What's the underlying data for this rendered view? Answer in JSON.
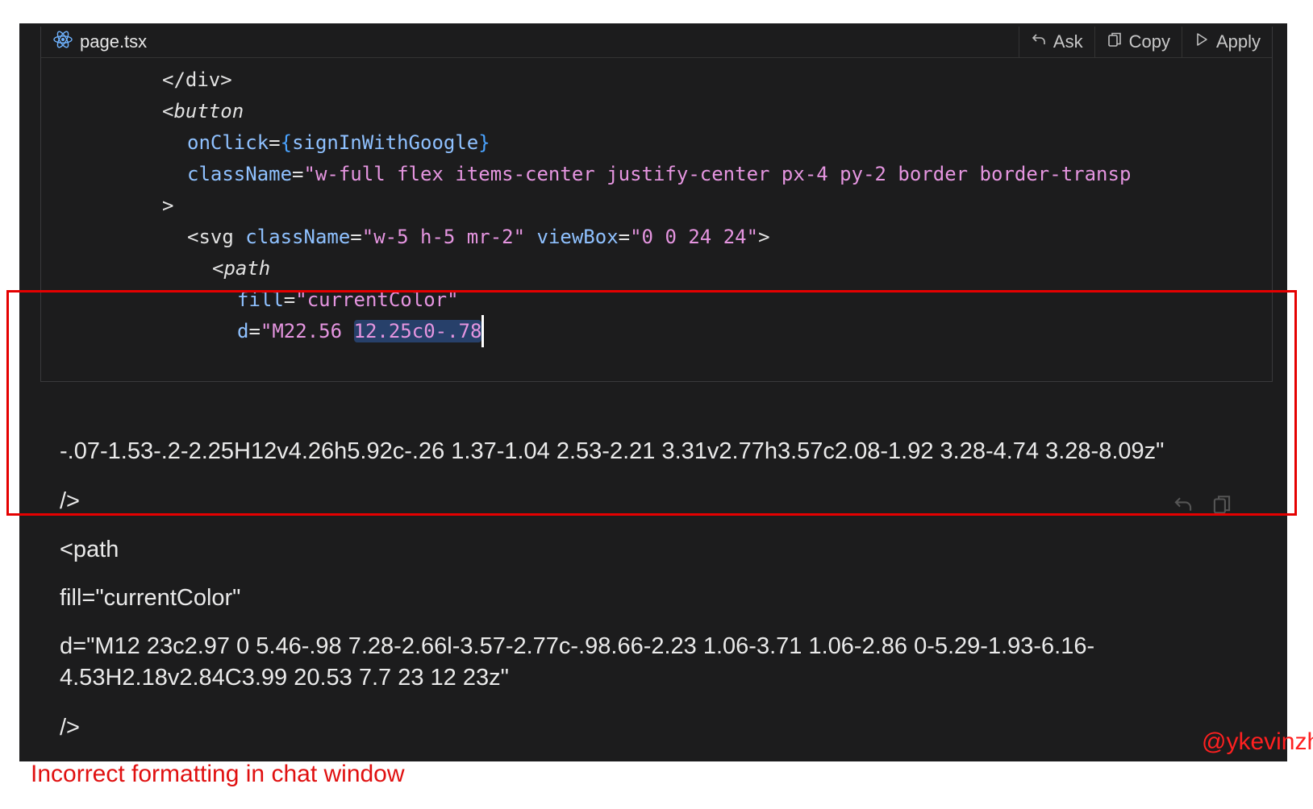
{
  "codeblock": {
    "filename": "page.tsx",
    "file_icon": "react-atom-icon",
    "actions": [
      {
        "label": "Ask",
        "icon": "undo-arrow-icon"
      },
      {
        "label": "Copy",
        "icon": "copy-icon"
      },
      {
        "label": "Apply",
        "icon": "play-icon"
      }
    ],
    "lines": {
      "l1": "</div>",
      "l2": "<button",
      "l3_attr": "onClick",
      "l3_eq": "=",
      "l3_open": "{",
      "l3_val": "signInWithGoogle",
      "l3_close": "}",
      "l4_attr": "className",
      "l4_eq": "=",
      "l4_val": "\"w-full flex items-center justify-center px-4 py-2 border border-transp",
      "l5": ">",
      "l6_tag": "<svg",
      "l6_attr1": "className",
      "l6_eq1": "=",
      "l6_val1": "\"w-5 h-5 mr-2\"",
      "l6_attr2": "viewBox",
      "l6_eq2": "=",
      "l6_val2": "\"0 0 24 24\"",
      "l6_end": ">",
      "l7": "<path",
      "l8_attr": "fill",
      "l8_eq": "=",
      "l8_val": "\"currentColor\"",
      "l9_attr": "d",
      "l9_eq": "=",
      "l9_val": "\"M22.56 ",
      "l9_sel": "12.25c0-.78"
    }
  },
  "prose": {
    "p1": "-.07-1.53-.2-2.25H12v4.26h5.92c-.26 1.37-1.04 2.53-2.21 3.31v2.77h3.57c2.08-1.92 3.28-4.74 3.28-8.09z\"",
    "p2": "/>",
    "p3": "<path",
    "p4": "fill=\"currentColor\"",
    "p5a": "d=\"M12 23c2.97 0 5.46-.98 7.28-2.66l-3.57-2.77c-.98.66-2.23 1.06-3.71 1.06-2.86 0-5.29-1.93-6.16-",
    "p5b": "4.53H2.18v2.84C3.99 20.53 7.7 23 12 23z\"",
    "p6": "/>"
  },
  "watermark": "@ykevinzhang",
  "caption": "Incorrect formatting in chat window",
  "colors": {
    "annotation": "#e50000",
    "panel_bg": "#1c1c1d"
  }
}
